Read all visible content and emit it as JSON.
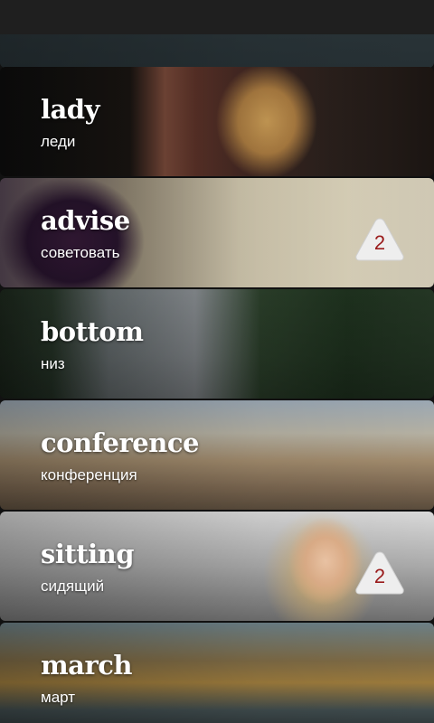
{
  "status_bar": {},
  "cards": [
    {
      "word": "",
      "translation": "",
      "badge": ""
    },
    {
      "word": "lady",
      "translation": "леди",
      "badge": ""
    },
    {
      "word": "advise",
      "translation": "советовать",
      "badge": "2"
    },
    {
      "word": "bottom",
      "translation": "низ",
      "badge": ""
    },
    {
      "word": "conference",
      "translation": "конференция",
      "badge": ""
    },
    {
      "word": "sitting",
      "translation": "сидящий",
      "badge": "2"
    },
    {
      "word": "march",
      "translation": "март",
      "badge": ""
    }
  ],
  "colors": {
    "badge_fill": "#eeeeee",
    "badge_number": "#9a1b1b",
    "status_bar": "#1f1f1f"
  }
}
